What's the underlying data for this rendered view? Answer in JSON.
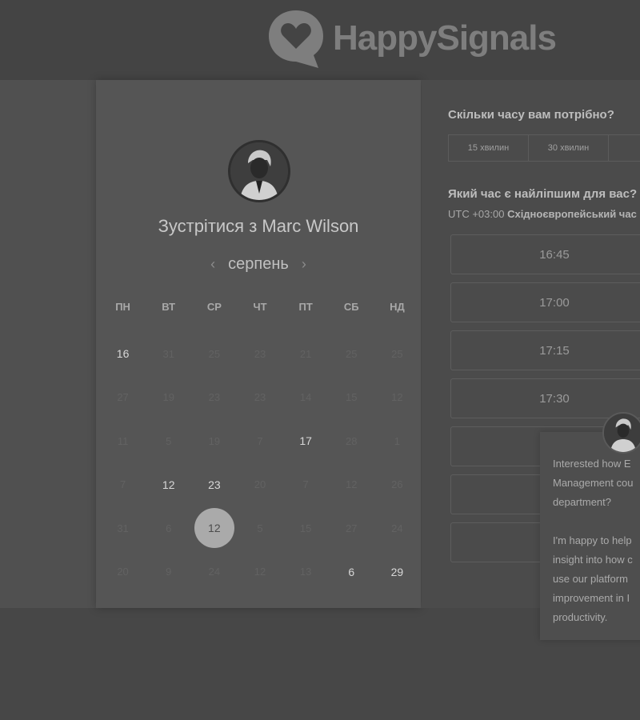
{
  "header": {
    "brand": "HappySignals",
    "logo_icon": "heart-chat-icon"
  },
  "calendar": {
    "title": "Зустрітися з Marc Wilson",
    "month": "серпень",
    "prev_icon": "‹",
    "next_icon": "›",
    "weekdays": [
      "ПН",
      "ВТ",
      "СР",
      "ЧТ",
      "ПТ",
      "СБ",
      "НД"
    ],
    "weeks": [
      [
        {
          "d": "16",
          "a": true
        },
        {
          "d": "31",
          "a": false
        },
        {
          "d": "25",
          "a": false
        },
        {
          "d": "23",
          "a": false
        },
        {
          "d": "21",
          "a": false
        },
        {
          "d": "25",
          "a": false
        },
        {
          "d": "25",
          "a": false
        }
      ],
      [
        {
          "d": "27",
          "a": false
        },
        {
          "d": "19",
          "a": false
        },
        {
          "d": "23",
          "a": false
        },
        {
          "d": "23",
          "a": false
        },
        {
          "d": "14",
          "a": false
        },
        {
          "d": "15",
          "a": false
        },
        {
          "d": "12",
          "a": false
        }
      ],
      [
        {
          "d": "11",
          "a": false
        },
        {
          "d": "5",
          "a": false
        },
        {
          "d": "19",
          "a": false
        },
        {
          "d": "7",
          "a": false
        },
        {
          "d": "17",
          "a": true
        },
        {
          "d": "28",
          "a": false
        },
        {
          "d": "1",
          "a": false
        }
      ],
      [
        {
          "d": "7",
          "a": false
        },
        {
          "d": "12",
          "a": true
        },
        {
          "d": "23",
          "a": true
        },
        {
          "d": "20",
          "a": false
        },
        {
          "d": "7",
          "a": false
        },
        {
          "d": "12",
          "a": false
        },
        {
          "d": "26",
          "a": false
        }
      ],
      [
        {
          "d": "31",
          "a": false
        },
        {
          "d": "6",
          "a": false
        },
        {
          "d": "12",
          "a": true,
          "s": true
        },
        {
          "d": "5",
          "a": false
        },
        {
          "d": "15",
          "a": false
        },
        {
          "d": "27",
          "a": false
        },
        {
          "d": "24",
          "a": false
        }
      ],
      [
        {
          "d": "20",
          "a": false
        },
        {
          "d": "9",
          "a": false
        },
        {
          "d": "24",
          "a": false
        },
        {
          "d": "12",
          "a": false
        },
        {
          "d": "13",
          "a": false
        },
        {
          "d": "6",
          "a": true
        },
        {
          "d": "29",
          "a": true
        }
      ]
    ]
  },
  "scheduling": {
    "duration_question": "Скільки часу вам потрібно?",
    "durations": [
      "15 хвилин",
      "30 хвилин"
    ],
    "time_question": "Який час є найліпшим для вас?",
    "timezone_offset": "UTC +03:00",
    "timezone_name": "Східноєвропейський час",
    "slots": [
      "16:45",
      "17:00",
      "17:15",
      "17:30",
      "",
      "",
      ""
    ]
  },
  "chat": {
    "lines_1": [
      "Interested how E",
      "Management cou",
      "department?"
    ],
    "lines_2": [
      "I'm happy to help",
      "insight into how c",
      "use our platform",
      "improvement in I",
      "productivity."
    ]
  },
  "colors": {
    "accent": "#aaaaaa",
    "background": "#4a4a4a"
  }
}
